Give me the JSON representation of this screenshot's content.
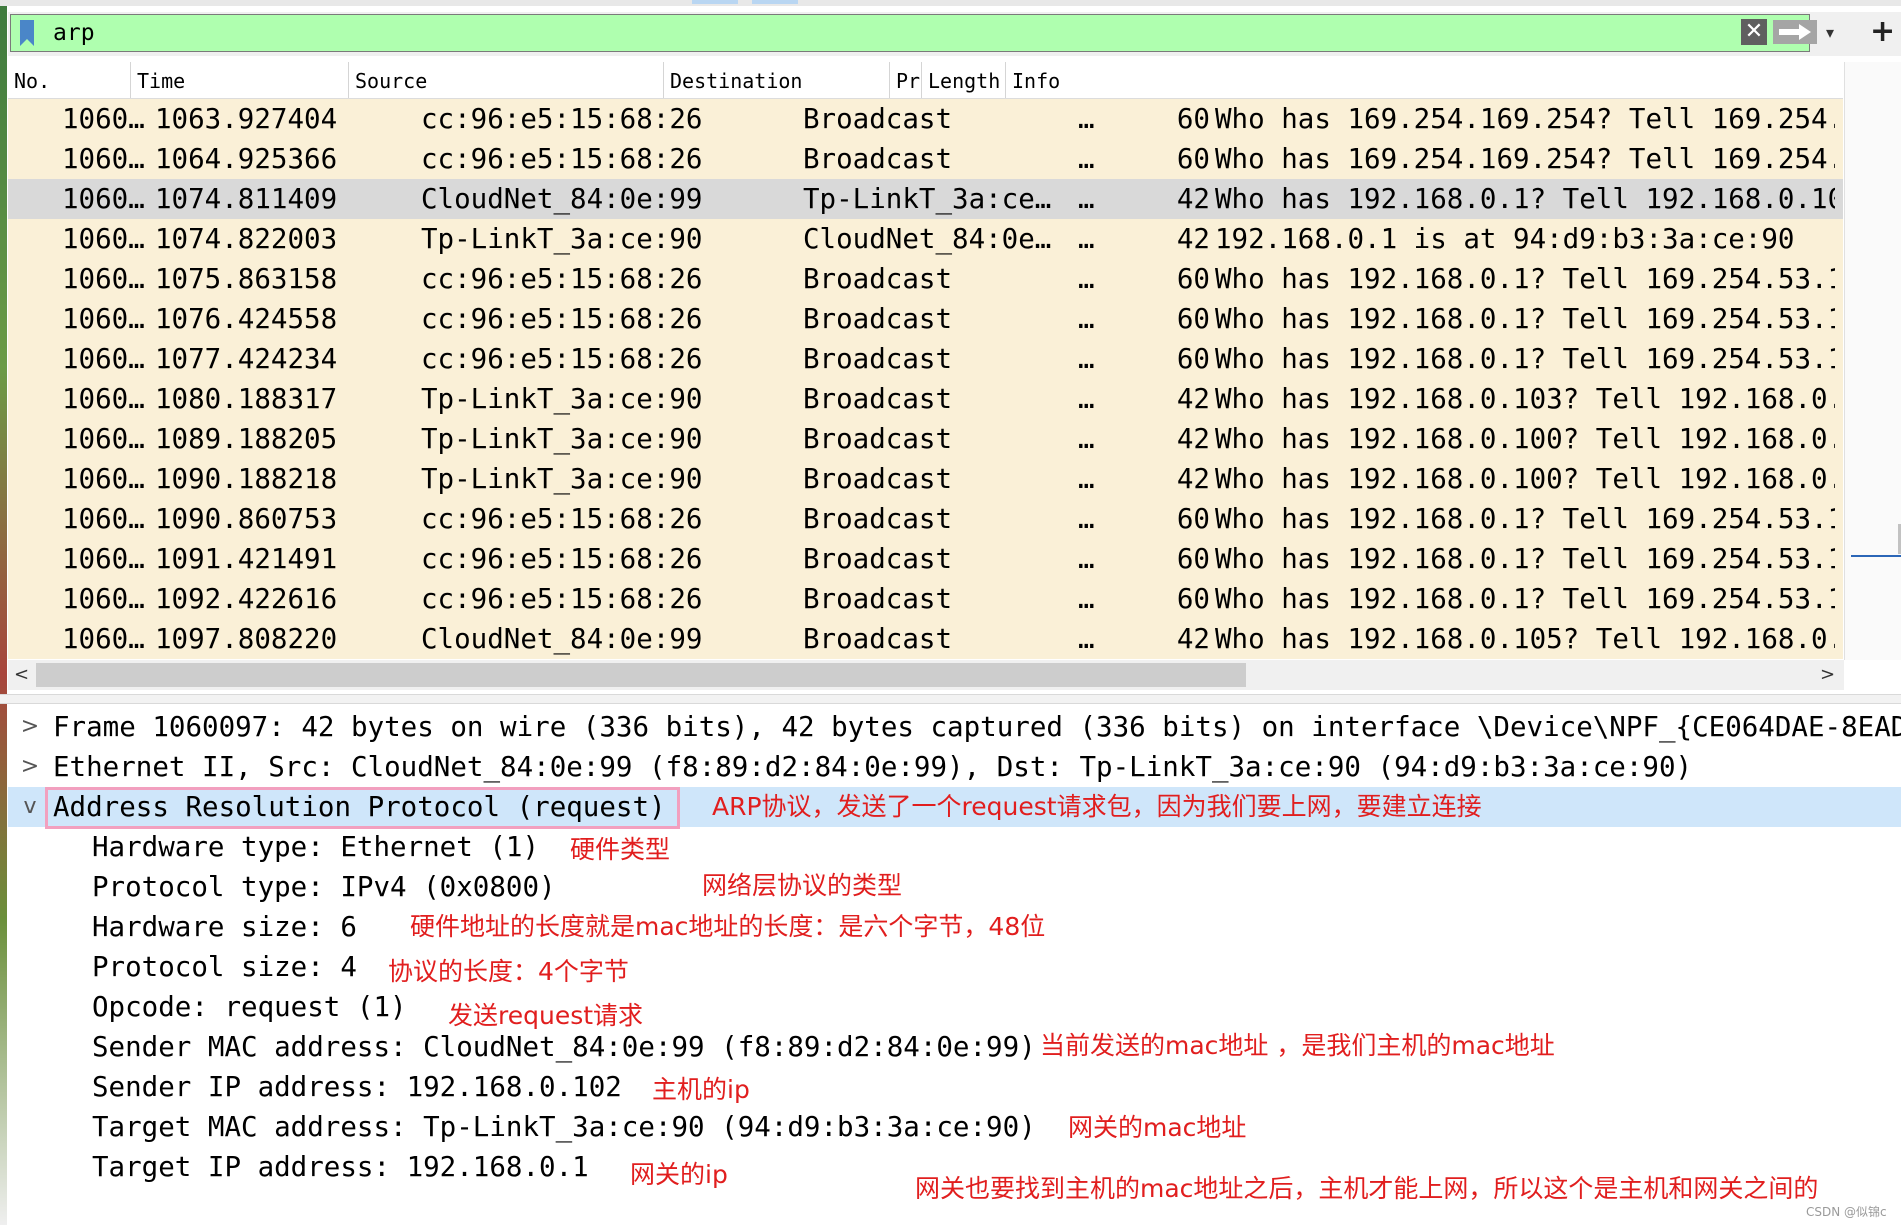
{
  "filter": {
    "value": "arp",
    "clear_icon": "✕",
    "add_icon": "+"
  },
  "columns": [
    "No.",
    "Time",
    "Source",
    "Destination",
    "Pr",
    "Length",
    "Info"
  ],
  "packets": [
    {
      "no": "1060…",
      "time": "1063.927404",
      "src": "cc:96:e5:15:68:26",
      "dst": "Broadcast",
      "pr": "…",
      "len": "60",
      "info": "Who has 169.254.169.254? Tell 169.254.",
      "selected": false
    },
    {
      "no": "1060…",
      "time": "1064.925366",
      "src": "cc:96:e5:15:68:26",
      "dst": "Broadcast",
      "pr": "…",
      "len": "60",
      "info": "Who has 169.254.169.254? Tell 169.254.",
      "selected": false
    },
    {
      "no": "1060…",
      "time": "1074.811409",
      "src": "CloudNet_84:0e:99",
      "dst": "Tp-LinkT_3a:ce…",
      "pr": "…",
      "len": "42",
      "info": "Who has 192.168.0.1? Tell 192.168.0.10",
      "selected": true
    },
    {
      "no": "1060…",
      "time": "1074.822003",
      "src": "Tp-LinkT_3a:ce:90",
      "dst": "CloudNet_84:0e…",
      "pr": "…",
      "len": "42",
      "info": "192.168.0.1 is at 94:d9:b3:3a:ce:90",
      "selected": false
    },
    {
      "no": "1060…",
      "time": "1075.863158",
      "src": "cc:96:e5:15:68:26",
      "dst": "Broadcast",
      "pr": "…",
      "len": "60",
      "info": "Who has 192.168.0.1? Tell 169.254.53.1",
      "selected": false
    },
    {
      "no": "1060…",
      "time": "1076.424558",
      "src": "cc:96:e5:15:68:26",
      "dst": "Broadcast",
      "pr": "…",
      "len": "60",
      "info": "Who has 192.168.0.1? Tell 169.254.53.1",
      "selected": false
    },
    {
      "no": "1060…",
      "time": "1077.424234",
      "src": "cc:96:e5:15:68:26",
      "dst": "Broadcast",
      "pr": "…",
      "len": "60",
      "info": "Who has 192.168.0.1? Tell 169.254.53.1",
      "selected": false
    },
    {
      "no": "1060…",
      "time": "1080.188317",
      "src": "Tp-LinkT_3a:ce:90",
      "dst": "Broadcast",
      "pr": "…",
      "len": "42",
      "info": "Who has 192.168.0.103? Tell 192.168.0.",
      "selected": false
    },
    {
      "no": "1060…",
      "time": "1089.188205",
      "src": "Tp-LinkT_3a:ce:90",
      "dst": "Broadcast",
      "pr": "…",
      "len": "42",
      "info": "Who has 192.168.0.100? Tell 192.168.0.",
      "selected": false
    },
    {
      "no": "1060…",
      "time": "1090.188218",
      "src": "Tp-LinkT_3a:ce:90",
      "dst": "Broadcast",
      "pr": "…",
      "len": "42",
      "info": "Who has 192.168.0.100? Tell 192.168.0.",
      "selected": false
    },
    {
      "no": "1060…",
      "time": "1090.860753",
      "src": "cc:96:e5:15:68:26",
      "dst": "Broadcast",
      "pr": "…",
      "len": "60",
      "info": "Who has 192.168.0.1? Tell 169.254.53.1",
      "selected": false
    },
    {
      "no": "1060…",
      "time": "1091.421491",
      "src": "cc:96:e5:15:68:26",
      "dst": "Broadcast",
      "pr": "…",
      "len": "60",
      "info": "Who has 192.168.0.1? Tell 169.254.53.1",
      "selected": false
    },
    {
      "no": "1060…",
      "time": "1092.422616",
      "src": "cc:96:e5:15:68:26",
      "dst": "Broadcast",
      "pr": "…",
      "len": "60",
      "info": "Who has 192.168.0.1? Tell 169.254.53.1",
      "selected": false
    },
    {
      "no": "1060…",
      "time": "1097.808220",
      "src": "CloudNet_84:0e:99",
      "dst": "Broadcast",
      "pr": "…",
      "len": "42",
      "info": "Who has 192.168.0.105? Tell 192.168.0.",
      "selected": false
    }
  ],
  "scroll_arrows": {
    "left": "<",
    "right": ">"
  },
  "details": {
    "frame": "Frame 1060097: 42 bytes on wire (336 bits), 42 bytes captured (336 bits) on interface \\Device\\NPF_{CE064DAE-8EAD",
    "ethernet": "Ethernet II, Src: CloudNet_84:0e:99 (f8:89:d2:84:0e:99), Dst: Tp-LinkT_3a:ce:90 (94:d9:b3:3a:ce:90)",
    "arp": "Address Resolution Protocol (request)",
    "collapsed_caret": ">",
    "expanded_caret": "v",
    "fields": [
      "Hardware type: Ethernet (1)",
      "Protocol type: IPv4 (0x0800)",
      "Hardware size: 6",
      "Protocol size: 4",
      "Opcode: request (1)",
      "Sender MAC address: CloudNet_84:0e:99 (f8:89:d2:84:0e:99)",
      "Sender IP address: 192.168.0.102",
      "Target MAC address: Tp-LinkT_3a:ce:90 (94:d9:b3:3a:ce:90)",
      "Target IP address: 192.168.0.1"
    ]
  },
  "annotations": {
    "arp": "ARP协议，发送了一个request请求包，因为我们要上网，要建立连接",
    "hardware_type": "硬件类型",
    "protocol_type": "网络层协议的类型",
    "hardware_size": "硬件地址的长度就是mac地址的长度：是六个字节，48位",
    "protocol_size": "协议的长度：4个字节",
    "opcode": "发送request请求",
    "sender_mac": "当前发送的mac地址 ，是我们主机的mac地址",
    "sender_ip": "主机的ip",
    "target_mac": "网关的mac地址",
    "target_ip": "网关的ip",
    "summary": "网关也要找到主机的mac地址之后，主机才能上网，所以这个是主机和网关之间的"
  },
  "watermark": "CSDN @似锦c",
  "colors": {
    "filter_ok": "#afffaf",
    "row_bg": "#faf0d7",
    "row_selected": "#d9d9d9",
    "detail_selected": "#cfe6fa",
    "annotation": "#e11e1e",
    "highlight_box": "#f2a0bf"
  }
}
